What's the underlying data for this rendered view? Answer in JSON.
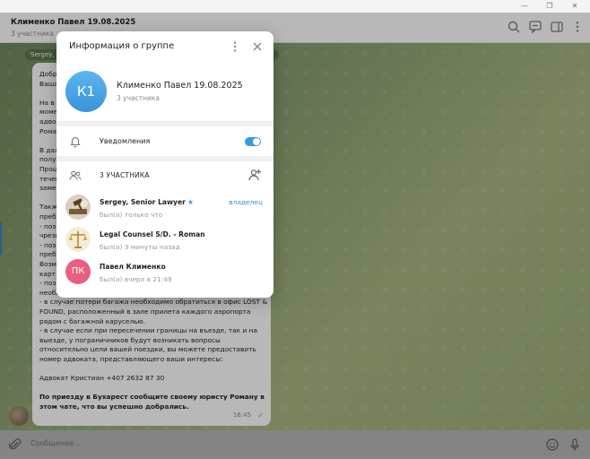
{
  "window": {
    "minimize": "—",
    "maximize": "❐",
    "close": "✕"
  },
  "chat": {
    "title": "Клименко Павел 19.08.2025",
    "subtitle": "3 участника",
    "date_pill": "Sergey,",
    "message_lines": [
      {
        "text": "Добр",
        "bold": false
      },
      {
        "text": "Ваша",
        "bold": false
      },
      {
        "text": "",
        "bold": false
      },
      {
        "text": "На в",
        "bold": false
      },
      {
        "text": "моме",
        "bold": false
      },
      {
        "text": "адво",
        "bold": false
      },
      {
        "text": "Рома",
        "bold": false
      },
      {
        "text": "",
        "bold": false
      },
      {
        "text": "В дал",
        "bold": false
      },
      {
        "text": "полу",
        "bold": false
      },
      {
        "text": "Прош",
        "bold": false
      },
      {
        "text": "течен",
        "bold": false
      },
      {
        "text": "заме",
        "bold": false
      },
      {
        "text": "",
        "bold": false
      },
      {
        "text": "Такж",
        "bold": false
      },
      {
        "text": "преб",
        "bold": false
      },
      {
        "text": "- поз",
        "bold": false
      },
      {
        "text": "чрезв",
        "bold": false
      },
      {
        "text": "- поз",
        "bold": false
      },
      {
        "text": "преб",
        "bold": false
      },
      {
        "text": "Возм",
        "bold": false
      },
      {
        "text": "карт",
        "bold": false
      },
      {
        "text": "- поз",
        "bold": false
      },
      {
        "text": "необходимые вам медицинские препараты;",
        "bold": false
      },
      {
        "text": "- в случае потери багажа необходимо обратиться в офис LOST &",
        "bold": false
      },
      {
        "text": "FOUND, расположенный в зале прилета каждого аэропорта",
        "bold": false
      },
      {
        "text": "рядом с багажной каруселью.",
        "bold": false
      },
      {
        "text": "- в случае если при пересечении границы на въезде, так и на",
        "bold": false
      },
      {
        "text": "выезде, у пограничников будут возникать вопросы",
        "bold": false
      },
      {
        "text": "относительно цели вашей поездки, вы можете предоставить",
        "bold": false
      },
      {
        "text": "номер адвоката, представляющего ваши интересы:",
        "bold": false
      },
      {
        "text": "",
        "bold": false
      },
      {
        "text": "Адвокат Кристиан +407 2632 87 30",
        "bold": false
      },
      {
        "text": "",
        "bold": false
      },
      {
        "text": "По приезду в Бухарест сообщите своему юристу Роману в",
        "bold": true
      },
      {
        "text": "этом чате, что вы успешно добрались.",
        "bold": true
      }
    ],
    "message_time": "16:45",
    "message_check": "✓"
  },
  "composer": {
    "placeholder": "Сообщение..."
  },
  "modal": {
    "title": "Информация о группе",
    "group_initials": "К1",
    "group_name": "Клименко Павел 19.08.2025",
    "group_members": "3 участника",
    "notifications_label": "Уведомления",
    "notifications_on": true,
    "members_header": "3 УЧАСТНИКА",
    "members": [
      {
        "name": "Sergey, Senior Lawyer",
        "status": "был(а) только что",
        "role": "владелец",
        "verified": true,
        "avatar": "photo-gavel"
      },
      {
        "name": "Legal Counsel S/D. - Roman",
        "status": "был(а) 3 минуты назад",
        "role": "",
        "verified": false,
        "avatar": "photo-scales"
      },
      {
        "name": "Павел Клименко",
        "status": "был(а) вчера в 21:49",
        "role": "",
        "verified": false,
        "avatar": "initials",
        "initials": "ПК"
      }
    ]
  },
  "colors": {
    "accent": "#3a9ae0",
    "owner_role": "#3b8bd0",
    "group_avatar": "#4aa6e8",
    "member_avatar_pk": "#e8607e",
    "chat_bg": "#8ba171"
  }
}
